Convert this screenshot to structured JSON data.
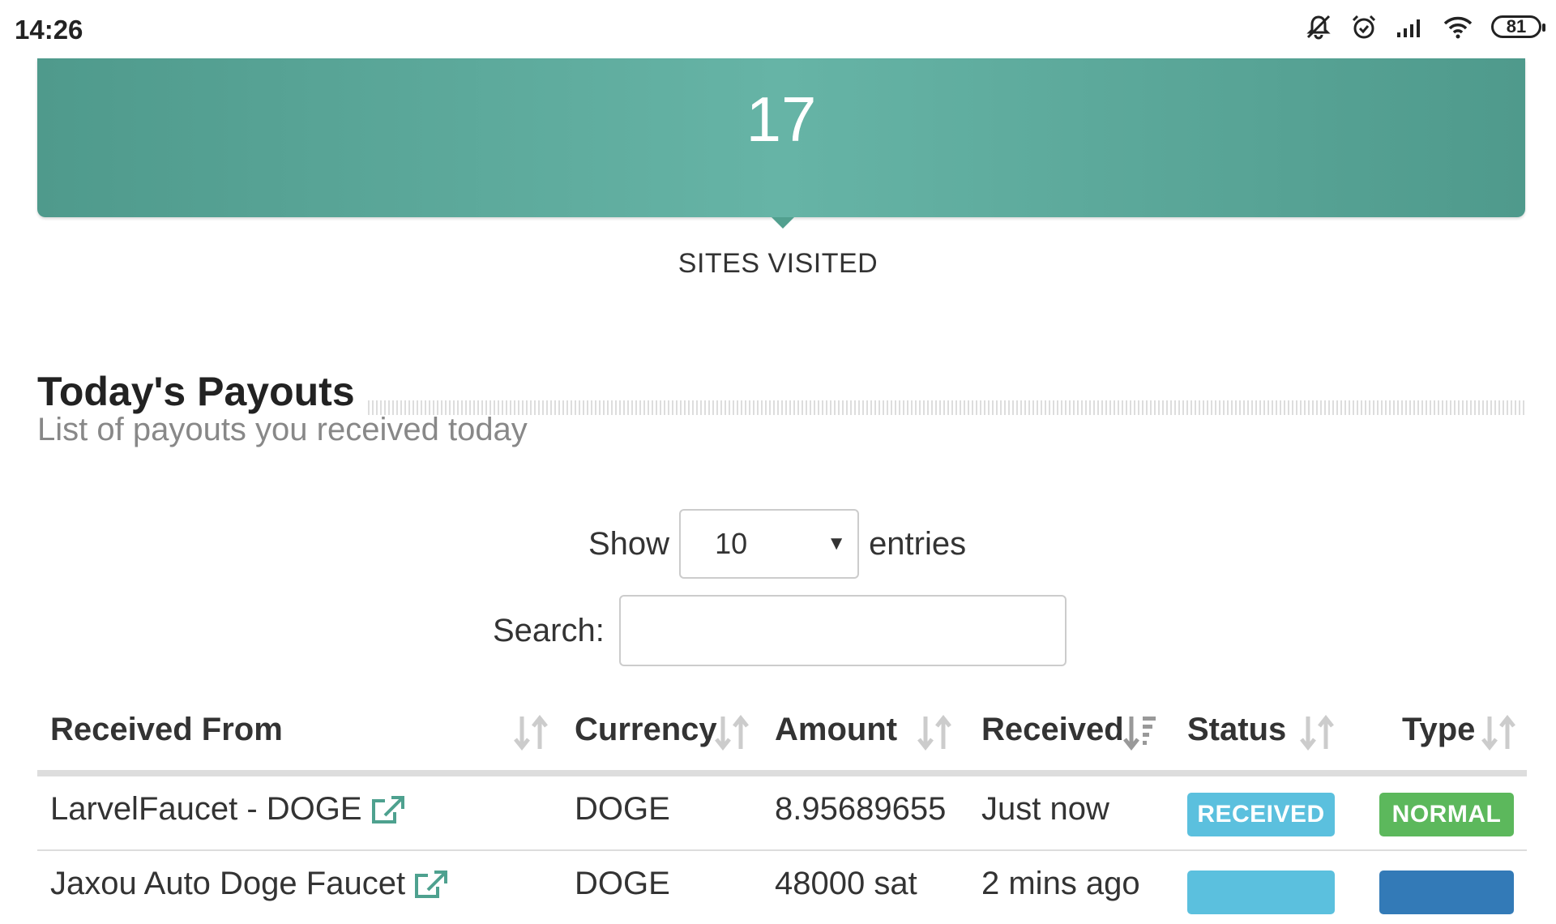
{
  "status_bar": {
    "time": "14:26",
    "battery": "81"
  },
  "stat": {
    "value": "17",
    "label": "SITES VISITED"
  },
  "section": {
    "title": "Today's Payouts",
    "subtitle": "List of payouts you received today"
  },
  "controls": {
    "show_label": "Show",
    "entries_value": "10",
    "entries_label": "entries",
    "search_label": "Search:",
    "search_value": ""
  },
  "table": {
    "headers": [
      "Received From",
      "Currency",
      "Amount",
      "Received",
      "Status",
      "Type"
    ],
    "rows": [
      {
        "from": "LarvelFaucet - DOGE",
        "currency": "DOGE",
        "amount": "8.95689655",
        "received": "Just now",
        "status": "RECEIVED",
        "type": "NORMAL"
      },
      {
        "from": "Jaxou Auto Doge Faucet",
        "currency": "DOGE",
        "amount": "48000 sat",
        "received": "2 mins ago",
        "status": "",
        "type": ""
      }
    ]
  },
  "colors": {
    "stat_bg": "#5aa898",
    "received_badge": "#5bc0de",
    "normal_badge": "#5cb85c",
    "primary_badge": "#337ab7"
  }
}
